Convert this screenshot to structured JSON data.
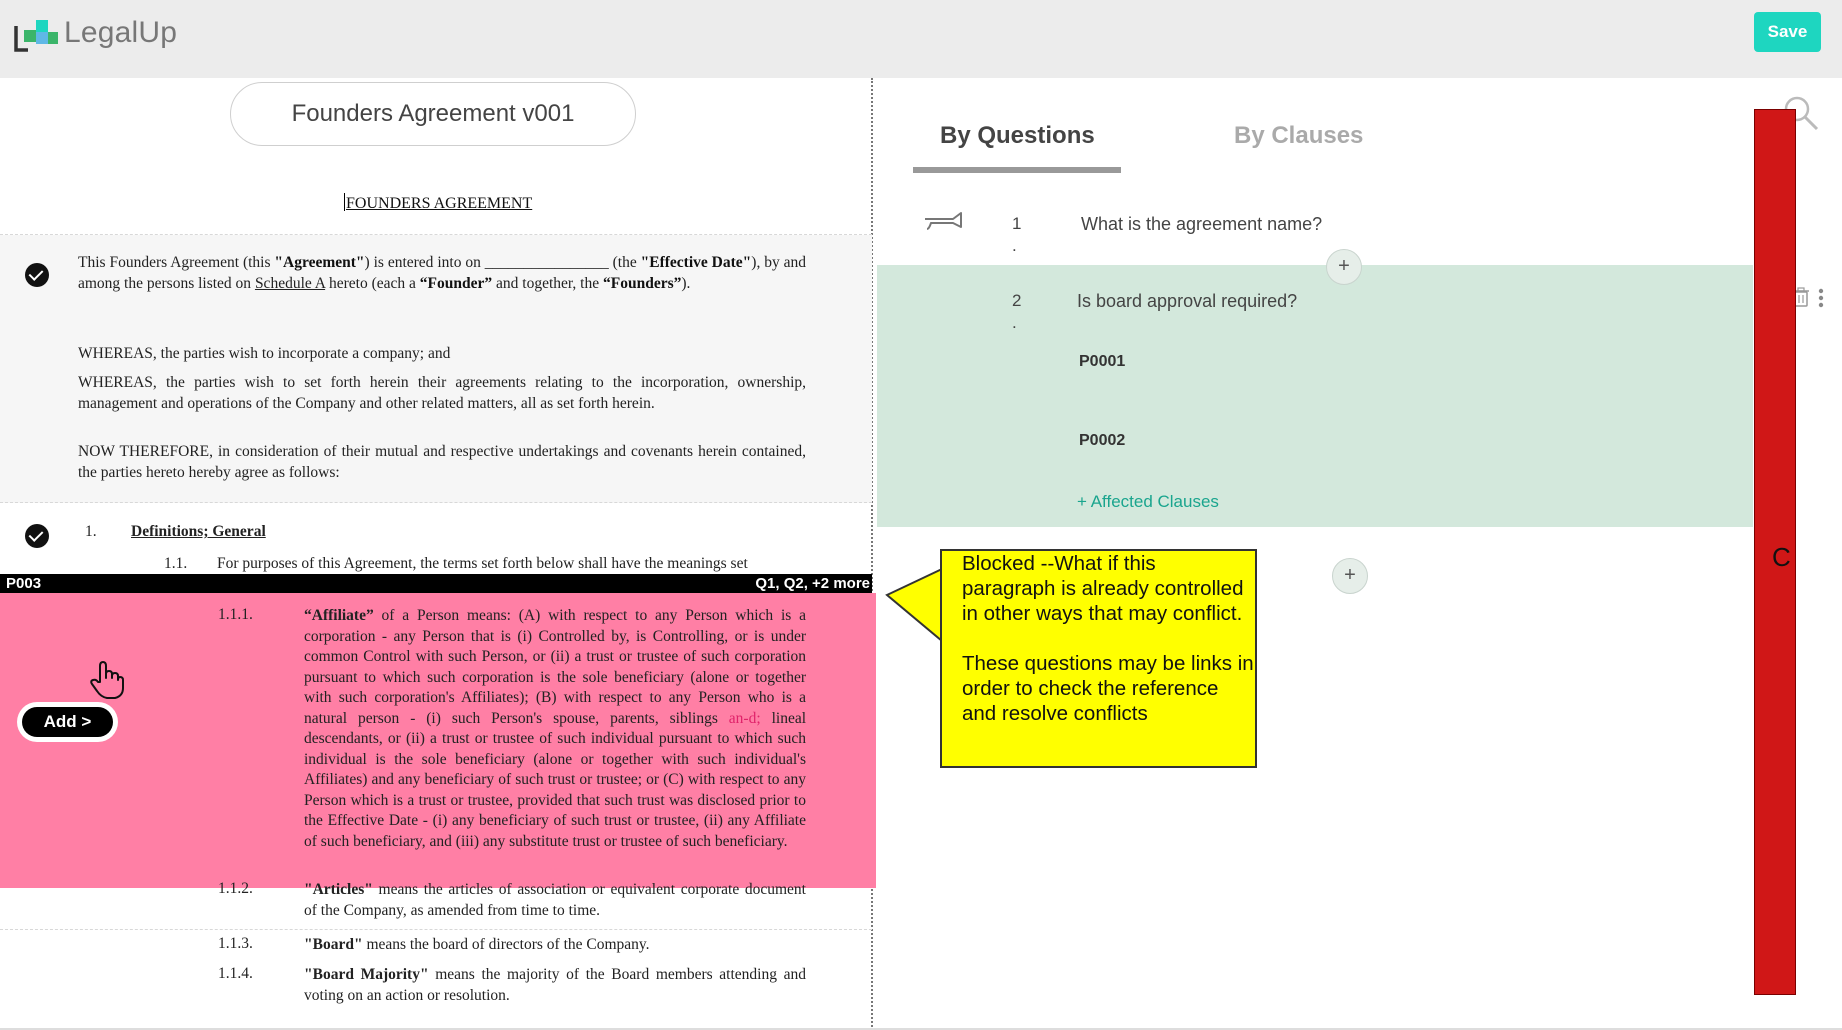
{
  "header": {
    "brand": "LegalUp",
    "save_label": "Save",
    "accent_color": "#1ed6c0"
  },
  "document": {
    "title": "Founders Agreement v001",
    "heading": "FOUNDERS AGREEMENT",
    "intro": {
      "t1": "This Founders Agreement (this ",
      "agreement": "\"Agreement\"",
      "t2": ") is entered into on ________________ (the ",
      "effective_date": "\"Effective Date\"",
      "t3": "), by and among the persons listed on ",
      "schedule": "Schedule A",
      "t4": " hereto (each a ",
      "founder": "“Founder”",
      "t5": " and together, the ",
      "founders": "“Founders”",
      "t6": ")."
    },
    "whereas_1": "WHEREAS, the parties wish to incorporate a company; and",
    "whereas_2": "WHEREAS, the parties wish to set forth herein their agreements relating to the incorporation, ownership, management and operations of the Company and other related matters, all as set forth herein.",
    "now_therefore": "NOW THEREFORE, in consideration of their mutual and respective undertakings and covenants herein contained, the parties hereto hereby agree as follows:",
    "section_1": {
      "num": "1.",
      "title": "Definitions; General"
    },
    "section_1_1": {
      "num": "1.1.",
      "text": "For purposes of this Agreement, the terms set forth below shall have the meanings set"
    },
    "selected_paragraph": {
      "id": "P003",
      "questions": "Q1, Q2, +2 more",
      "add_label": "Add >",
      "highlight_color": "#ff7fa5"
    },
    "def_affiliate": {
      "num": "1.1.1.",
      "term": "“Affiliate”",
      "t1": " of a Person means: (A) with respect to any Person which is a corporation - any Person that is (i) Controlled by, is Controlling, or is under common Control with such Person, or (ii) a trust or trustee of such corporation pursuant to which such corporation is the sole beneficiary (alone or together with such corporation's Affiliates); (B) with respect to any Person who is a natural person - (i) such Person's spouse, parents, siblings ",
      "pink": "an-d;",
      "t2": " lineal descendants, or (ii) a trust or trustee of such individual pursuant to which such individual is the sole beneficiary (alone or together with such individual's Affiliates) and any beneficiary of such trust or trustee; or (C) with respect to any Person which is a trust or trustee, provided that such trust was disclosed prior to the Effective Date - (i) any beneficiary of such trust or trustee, (ii) any Affiliate of such beneficiary, and (iii) any substitute trust or trustee of such beneficiary."
    },
    "def_articles": {
      "num": "1.1.2.",
      "term": "\"Articles\"",
      "text": " means the articles of association or equivalent corporate document of the Company, as amended from time to time."
    },
    "def_board": {
      "num": "1.1.3.",
      "term": "\"Board\"",
      "text": " means the board of directors of the Company."
    },
    "def_board_majority": {
      "num": "1.1.4.",
      "term": "\"Board Majority\"",
      "text": " means the majority of the Board members attending and voting on an action or resolution."
    }
  },
  "right_panel": {
    "tabs": [
      {
        "label": "By Questions",
        "active": true
      },
      {
        "label": "By Clauses",
        "active": false
      }
    ],
    "questions": [
      {
        "num": "1",
        "dot": ".",
        "text": "What is the agreement name?"
      },
      {
        "num": "2",
        "dot": ".",
        "text": "Is board approval required?",
        "clauses": [
          "P0001",
          "P0002"
        ],
        "affected_label": "+ Affected  Clauses"
      }
    ],
    "add_symbol": "+",
    "selected_color": "#d3e8dc"
  },
  "annotation": {
    "red_bar_label": "C",
    "red_color": "#d01717",
    "callout_p1": "Blocked --What if this paragraph is already controlled in other ways that may conflict.",
    "callout_p2": "These questions may be links in order to check the reference and resolve conflicts",
    "callout_color": "#ffff00"
  }
}
